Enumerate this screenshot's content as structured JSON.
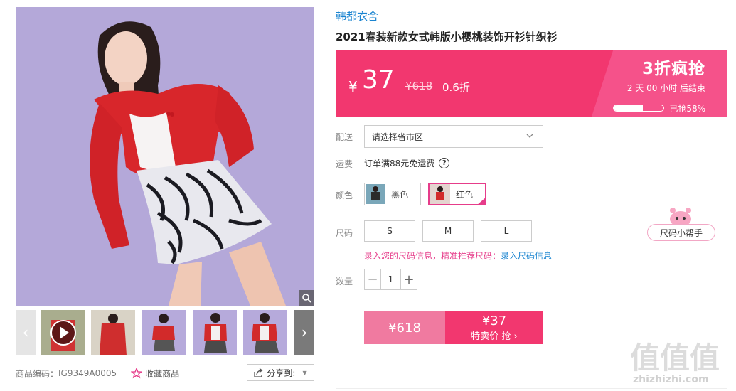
{
  "gallery": {
    "thumbs": [
      "thumb-video",
      "thumb-2",
      "thumb-3",
      "thumb-4",
      "thumb-5",
      "thumb-6"
    ],
    "sku_label": "商品编码：",
    "sku_value": "IG9349A0005",
    "favorite_label": "收藏商品",
    "share_label": "分享到:"
  },
  "product": {
    "brand": "韩都衣舍",
    "title": "2021春装新款女式韩版小樱桃装饰开衫针织衫"
  },
  "price": {
    "currency": "¥",
    "current": "37",
    "original": "¥618",
    "discount": "0.6折",
    "promo_title": "3折疯抢",
    "countdown": "2 天 00 小时 后结束",
    "sold_percent": 58,
    "sold_text": "已抢58%",
    "colors": {
      "bar": "#f2376f",
      "accent": "#e63c8a",
      "link": "#1a84d0"
    }
  },
  "delivery": {
    "label": "配送",
    "placeholder": "请选择省市区"
  },
  "shipping": {
    "label": "运费",
    "text": "订单满88元免运费",
    "help_icon": "question-circle-icon"
  },
  "color": {
    "label": "颜色",
    "options": [
      {
        "name": "黑色",
        "selected": false
      },
      {
        "name": "红色",
        "selected": true
      }
    ]
  },
  "size": {
    "label": "尺码",
    "options": [
      "S",
      "M",
      "L"
    ],
    "note": "录入您的尺码信息，精准推荐尺码：",
    "note_link": "录入尺码信息",
    "helper": "尺码小帮手"
  },
  "quantity": {
    "label": "数量",
    "value": "1",
    "minus": "−",
    "plus": "+"
  },
  "buy": {
    "old_price": "¥618",
    "price": "¥37",
    "label": "特卖价 抢"
  },
  "watermark": {
    "big": "值值值",
    "small": "zhizhizhi.com"
  }
}
